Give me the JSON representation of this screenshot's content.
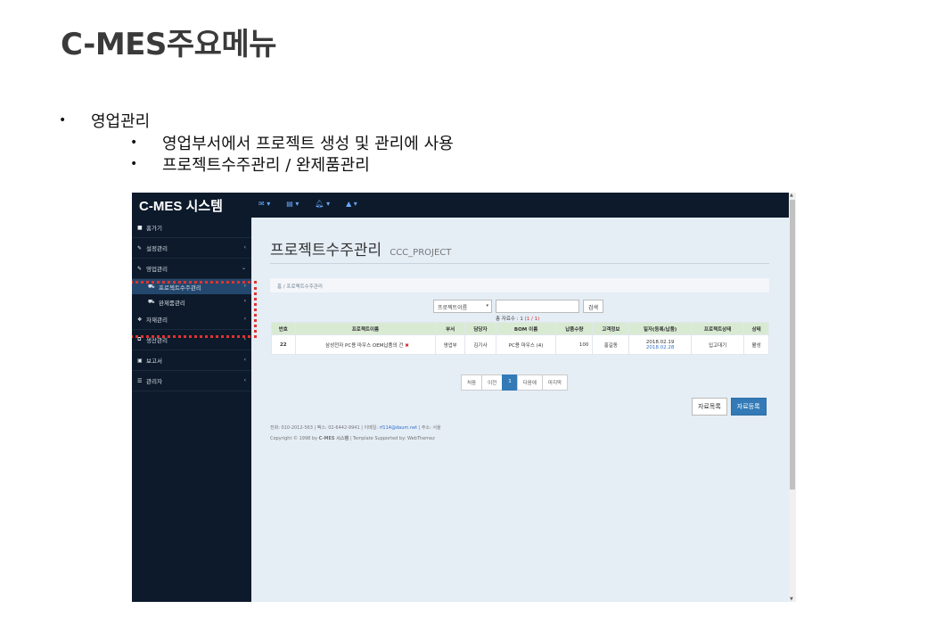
{
  "slide": {
    "title": "C-MES주요메뉴",
    "bullet": "영업관리",
    "sub_bullets": [
      "영업부서에서 프로젝트 생성 및 관리에 사용",
      "프로젝트수주관리 / 완제품관리"
    ]
  },
  "app": {
    "brand": "C-MES 시스템",
    "top_icons": [
      "mail-icon",
      "list-icon",
      "bell-icon",
      "user-icon"
    ],
    "sidebar": {
      "items": [
        {
          "label": "홈가기",
          "icon": "file-icon"
        },
        {
          "label": "설정관리",
          "icon": "wrench-icon"
        },
        {
          "label": "영업관리",
          "icon": "wrench-icon"
        },
        {
          "label": "프로젝트수주관리",
          "icon": "car-icon"
        },
        {
          "label": "완제품관리",
          "icon": "car-icon"
        },
        {
          "label": "자재관리",
          "icon": "cubes-icon"
        },
        {
          "label": "생산관리",
          "icon": "external-icon"
        },
        {
          "label": "보고서",
          "icon": "report-icon"
        },
        {
          "label": "관리자",
          "icon": "sliders-icon"
        }
      ]
    },
    "page": {
      "title": "프로젝트수주관리",
      "subtitle": "CCC_PROJECT",
      "breadcrumb": [
        "홈",
        "프로젝트수주관리"
      ]
    },
    "search": {
      "select_value": "프로젝트이름",
      "input_value": "",
      "button": "검색"
    },
    "count_text": "총 자료수 : 1",
    "count_pages": "(1 / 1)",
    "table": {
      "headers": [
        "번호",
        "프로젝트이름",
        "부서",
        "담당자",
        "BOM 이름",
        "납품수량",
        "고객정보",
        "일자(등록/납품)",
        "프로젝트상태",
        "상태"
      ],
      "rows": [
        {
          "no": "22",
          "name": "삼성전자 PC용 마우스 OEM납품의 건",
          "dept": "영업부",
          "manager": "김기사",
          "bom": "PC용 마우스 (4)",
          "qty": "100",
          "customer": "홍길동",
          "date_reg": "2018.02.19",
          "date_deliv": "2018.02.28",
          "project_status": "입고대기",
          "status": "활성"
        }
      ]
    },
    "pager": [
      "처음",
      "이전",
      "1",
      "다음에",
      "마지막"
    ],
    "buttons": {
      "list": "자료목록",
      "register": "자료등록"
    },
    "footer": {
      "contact_pre": "전화: 010-2012-563 | 팩스: 02-6442-9941 | 이메일: ",
      "email": "rf114@daum.net",
      "contact_post": " | 주소: 서울",
      "copyright_pre": "Copyright © 1998 by ",
      "copyright_brand": "C-MES 시스템",
      "copyright_post": " | Template Supported by: WebThemez"
    }
  }
}
